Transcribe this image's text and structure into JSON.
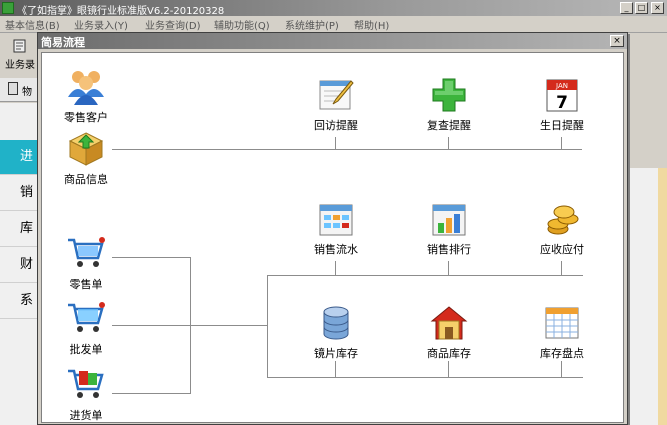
{
  "window": {
    "title": "《了如指掌》眼镜行业标准版V6.2-20120328",
    "minimize_glyph": "_",
    "maximize_glyph": "□",
    "close_glyph": "×"
  },
  "menu": [
    "基本信息(B)",
    "业务录入(Y)",
    "业务查询(D)",
    "辅助功能(Q)",
    "系统维护(P)",
    "帮助(H)"
  ],
  "toolbar": {
    "label": "业务录"
  },
  "tab": {
    "label": "物"
  },
  "left_nav": [
    {
      "label": "进",
      "active": true
    },
    {
      "label": "销",
      "active": false
    },
    {
      "label": "库",
      "active": false
    },
    {
      "label": "财",
      "active": false
    },
    {
      "label": "系",
      "active": false
    }
  ],
  "dialog": {
    "title": "简易流程",
    "close_glyph": "×",
    "items": {
      "retail_customer": {
        "label": "零售客户",
        "icon": "users-icon"
      },
      "product_info": {
        "label": "商品信息",
        "icon": "product-box-icon"
      },
      "retail_order": {
        "label": "零售单",
        "icon": "cart-icon"
      },
      "wholesale_order": {
        "label": "批发单",
        "icon": "cart-icon"
      },
      "purchase_order": {
        "label": "进货单",
        "icon": "cart-icon"
      },
      "followup_reminder": {
        "label": "回访提醒",
        "icon": "notepad-pencil-icon"
      },
      "recheck_reminder": {
        "label": "复查提醒",
        "icon": "green-plus-icon"
      },
      "birthday_reminder": {
        "label": "生日提醒",
        "icon": "calendar-icon",
        "calendar_month": "JAN",
        "calendar_day": "7"
      },
      "sales_journal": {
        "label": "销售流水",
        "icon": "ledger-icon"
      },
      "sales_ranking": {
        "label": "销售排行",
        "icon": "bar-chart-icon"
      },
      "receivables_payables": {
        "label": "应收应付",
        "icon": "coins-icon"
      },
      "lens_inventory": {
        "label": "镜片库存",
        "icon": "database-icon"
      },
      "product_inventory": {
        "label": "商品库存",
        "icon": "warehouse-icon"
      },
      "stocktake": {
        "label": "库存盘点",
        "icon": "spreadsheet-icon"
      }
    }
  },
  "colors": {
    "accent_nav": "#20b2c8",
    "green_plus": "#3cb43c",
    "calendar_red": "#d42a1c"
  }
}
